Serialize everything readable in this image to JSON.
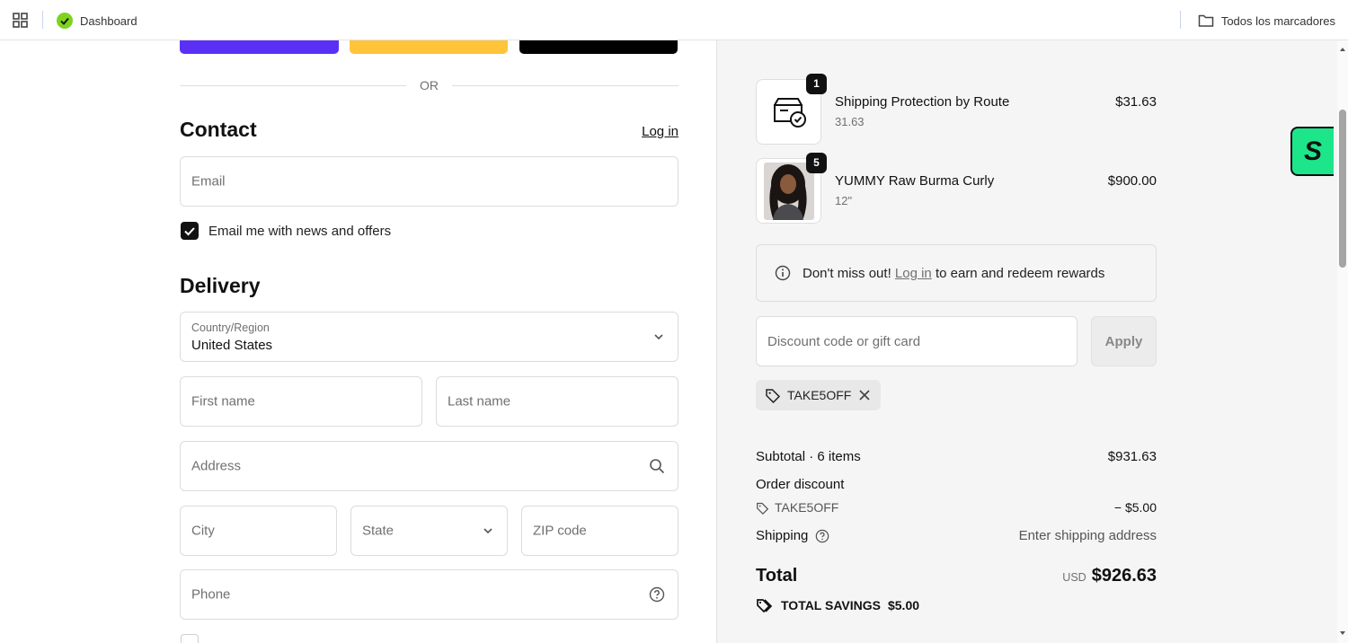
{
  "bookmarks_bar": {
    "dashboard_label": "Dashboard",
    "all_bookmarks_label": "Todos los marcadores"
  },
  "checkout": {
    "express": {
      "colors": [
        "#5a31f4",
        "#ffc439",
        "#000000"
      ],
      "or_text": "OR"
    },
    "contact": {
      "heading": "Contact",
      "login_link": "Log in",
      "email_placeholder": "Email",
      "newsletter_label": "Email me with news and offers",
      "newsletter_checked": true
    },
    "delivery": {
      "heading": "Delivery",
      "country_label": "Country/Region",
      "country_value": "United States",
      "first_name_placeholder": "First name",
      "last_name_placeholder": "Last name",
      "address_placeholder": "Address",
      "city_placeholder": "City",
      "state_placeholder": "State",
      "zip_placeholder": "ZIP code",
      "phone_placeholder": "Phone"
    }
  },
  "order_summary": {
    "items": [
      {
        "name": "Shipping Protection by Route",
        "variant": "31.63",
        "price": "$31.63",
        "quantity": "1",
        "icon": "package-check-icon"
      },
      {
        "name": "YUMMY Raw Burma Curly",
        "variant": "12\"",
        "price": "$900.00",
        "quantity": "5",
        "icon": "product-photo"
      }
    ],
    "rewards": {
      "prefix": "Don't miss out!",
      "link": "Log in",
      "suffix": "to earn and redeem rewards"
    },
    "discount": {
      "placeholder": "Discount code or gift card",
      "apply_label": "Apply",
      "applied_code": "TAKE5OFF"
    },
    "subtotal_label": "Subtotal · 6 items",
    "subtotal_value": "$931.63",
    "order_discount_label": "Order discount",
    "order_discount_code": "TAKE5OFF",
    "order_discount_value": "− $5.00",
    "shipping_label": "Shipping",
    "shipping_value": "Enter shipping address",
    "total_label": "Total",
    "total_currency": "USD",
    "total_value": "$926.63",
    "savings_label": "TOTAL SAVINGS",
    "savings_value": "$5.00"
  },
  "floating_badge": {
    "letter": "S",
    "color": "#1de58a"
  }
}
